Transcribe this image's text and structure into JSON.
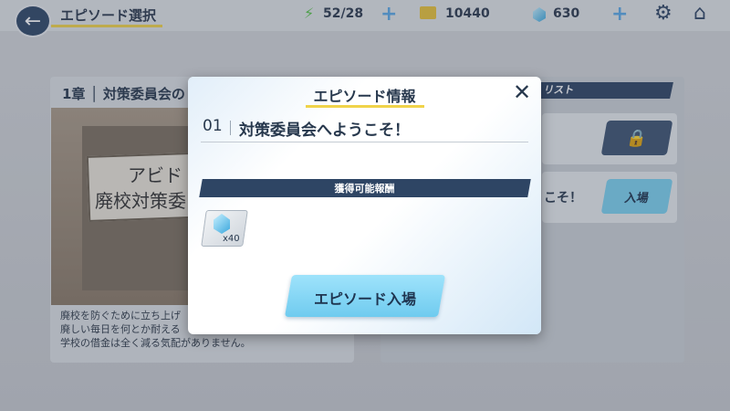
{
  "header": {
    "title": "エピソード選択",
    "ap": "52/28",
    "credits": "10440",
    "gems": "630"
  },
  "icons": {
    "back": "arrow-left-icon",
    "ap": "lightning-icon",
    "credits": "credit-ticket-icon",
    "gems": "gem-icon",
    "settings": "gear-icon",
    "home": "home-icon",
    "lock": "lock-icon"
  },
  "background": {
    "chapter_title": "1章 │ 対策委員会の",
    "sign_line1": "アビド",
    "sign_line2": "廃校対策委",
    "description": "廃校を防ぐために立ち上げ\n廃しい毎日を何とか耐える\n学校の借金は全く減る気配がありません。",
    "list_tab": "リスト",
    "row2_text": "こそ！",
    "row2_button": "入場"
  },
  "modal": {
    "title": "エピソード情報",
    "episode_number": "01",
    "episode_title": "対策委員会へようこそ！",
    "reward_header": "獲得可能報酬",
    "reward_quantity": "x40",
    "enter_button": "エピソード入場"
  },
  "colors": {
    "navy": "#2e4564",
    "accent_yellow": "#f0d34a",
    "button_cyan": "#7cd1f0"
  }
}
